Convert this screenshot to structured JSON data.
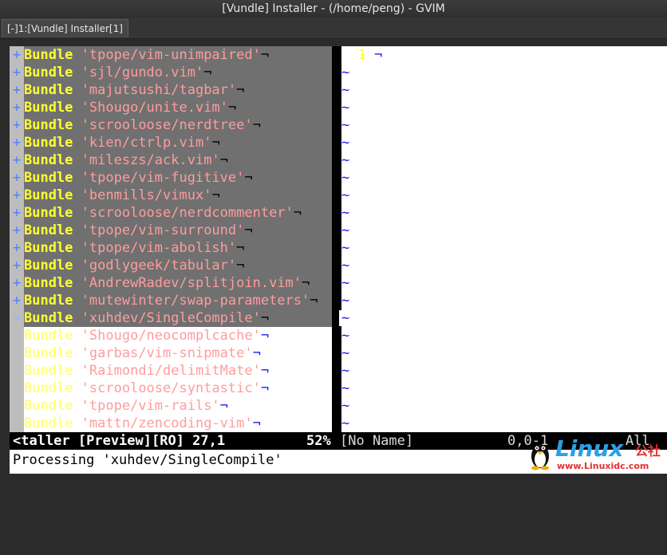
{
  "window": {
    "title": "[Vundle] Installer - (/home/peng) - GVIM"
  },
  "tab": {
    "label": "[-]1:[Vundle] Installer[1]"
  },
  "bundles": [
    {
      "sign": "+",
      "kw": "Bundle",
      "repo": "'tpope/vim-unimpaired'"
    },
    {
      "sign": "+",
      "kw": "Bundle",
      "repo": "'sjl/gundo.vim'"
    },
    {
      "sign": "+",
      "kw": "Bundle",
      "repo": "'majutsushi/tagbar'"
    },
    {
      "sign": "+",
      "kw": "Bundle",
      "repo": "'Shougo/unite.vim'"
    },
    {
      "sign": "+",
      "kw": "Bundle",
      "repo": "'scrooloose/nerdtree'"
    },
    {
      "sign": "+",
      "kw": "Bundle",
      "repo": "'kien/ctrlp.vim'"
    },
    {
      "sign": "+",
      "kw": "Bundle",
      "repo": "'mileszs/ack.vim'"
    },
    {
      "sign": "+",
      "kw": "Bundle",
      "repo": "'tpope/vim-fugitive'"
    },
    {
      "sign": "+",
      "kw": "Bundle",
      "repo": "'benmills/vimux'"
    },
    {
      "sign": "+",
      "kw": "Bundle",
      "repo": "'scrooloose/nerdcommenter'"
    },
    {
      "sign": "+",
      "kw": "Bundle",
      "repo": "'tpope/vim-surround'"
    },
    {
      "sign": "+",
      "kw": "Bundle",
      "repo": "'tpope/vim-abolish'"
    },
    {
      "sign": "+",
      "kw": "Bundle",
      "repo": "'godlygeek/tabular'"
    },
    {
      "sign": "+",
      "kw": "Bundle",
      "repo": "'AndrewRadev/splitjoin.vim'"
    },
    {
      "sign": "+",
      "kw": "Bundle",
      "repo": "'mutewinter/swap-parameters'"
    },
    {
      "sign": ">",
      "kw": "Bundle",
      "repo": "'xuhdev/SingleCompile'"
    },
    {
      "sign": "",
      "kw": "Bundle",
      "repo": "'Shougo/neocomplcache'"
    },
    {
      "sign": "",
      "kw": "Bundle",
      "repo": "'garbas/vim-snipmate'"
    },
    {
      "sign": "",
      "kw": "Bundle",
      "repo": "'Raimondi/delimitMate'"
    },
    {
      "sign": "",
      "kw": "Bundle",
      "repo": "'scrooloose/syntastic'"
    },
    {
      "sign": "",
      "kw": "Bundle",
      "repo": "'tpope/vim-rails'"
    },
    {
      "sign": "",
      "kw": "Bundle",
      "repo": "'mattn/zencoding-vim'"
    }
  ],
  "eol_char": "¬",
  "right_pane": {
    "first_line_number": "1",
    "tilde": "~",
    "tilde_count": 21
  },
  "status": {
    "left": "<taller [Preview][RO] 27,1",
    "percent": "52%",
    "right_name": "[No Name]",
    "right_pos": "0,0-1",
    "right_all": "All"
  },
  "cmdline": {
    "text": "Processing 'xuhdev/SingleCompile'"
  },
  "watermark": {
    "brand": "Linux",
    "brand_cn": "公社",
    "url": "www.Linuxidc.com"
  },
  "colors": {
    "keyword": "#ffff33",
    "string": "#ff9c9c",
    "sign": "#4a82ff",
    "tilde": "#1919ff",
    "highlight_bg": "#707070"
  }
}
